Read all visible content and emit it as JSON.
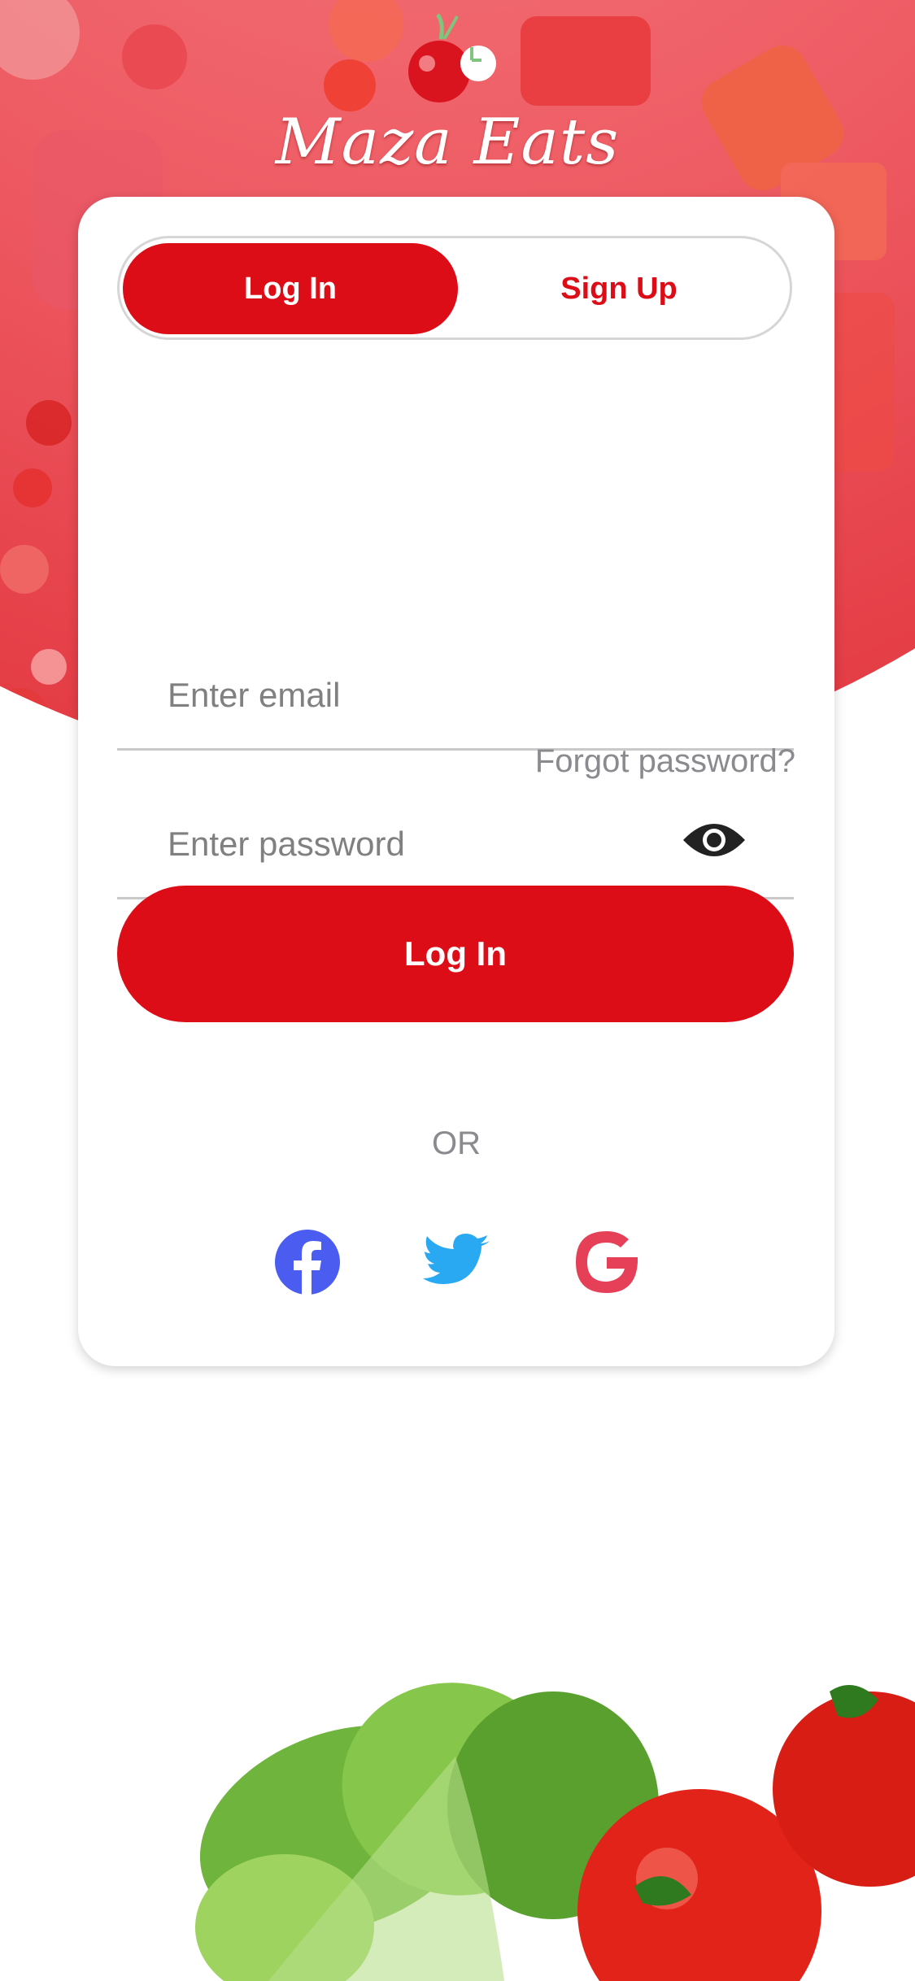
{
  "brand": {
    "name": "Maza Eats"
  },
  "tabs": {
    "login_label": "Log In",
    "signup_label": "Sign Up"
  },
  "form": {
    "email_placeholder": "Enter email",
    "password_placeholder": "Enter password",
    "forgot_password": "Forgot password?",
    "submit_label": "Log In",
    "or_label": "OR"
  },
  "social": {
    "facebook_icon": "facebook-icon",
    "twitter_icon": "twitter-icon",
    "google_icon": "google-icon"
  },
  "colors": {
    "accent": "#dd0d18",
    "facebook": "#4a5df0",
    "twitter": "#2aa9f3",
    "google": "#e54058"
  }
}
